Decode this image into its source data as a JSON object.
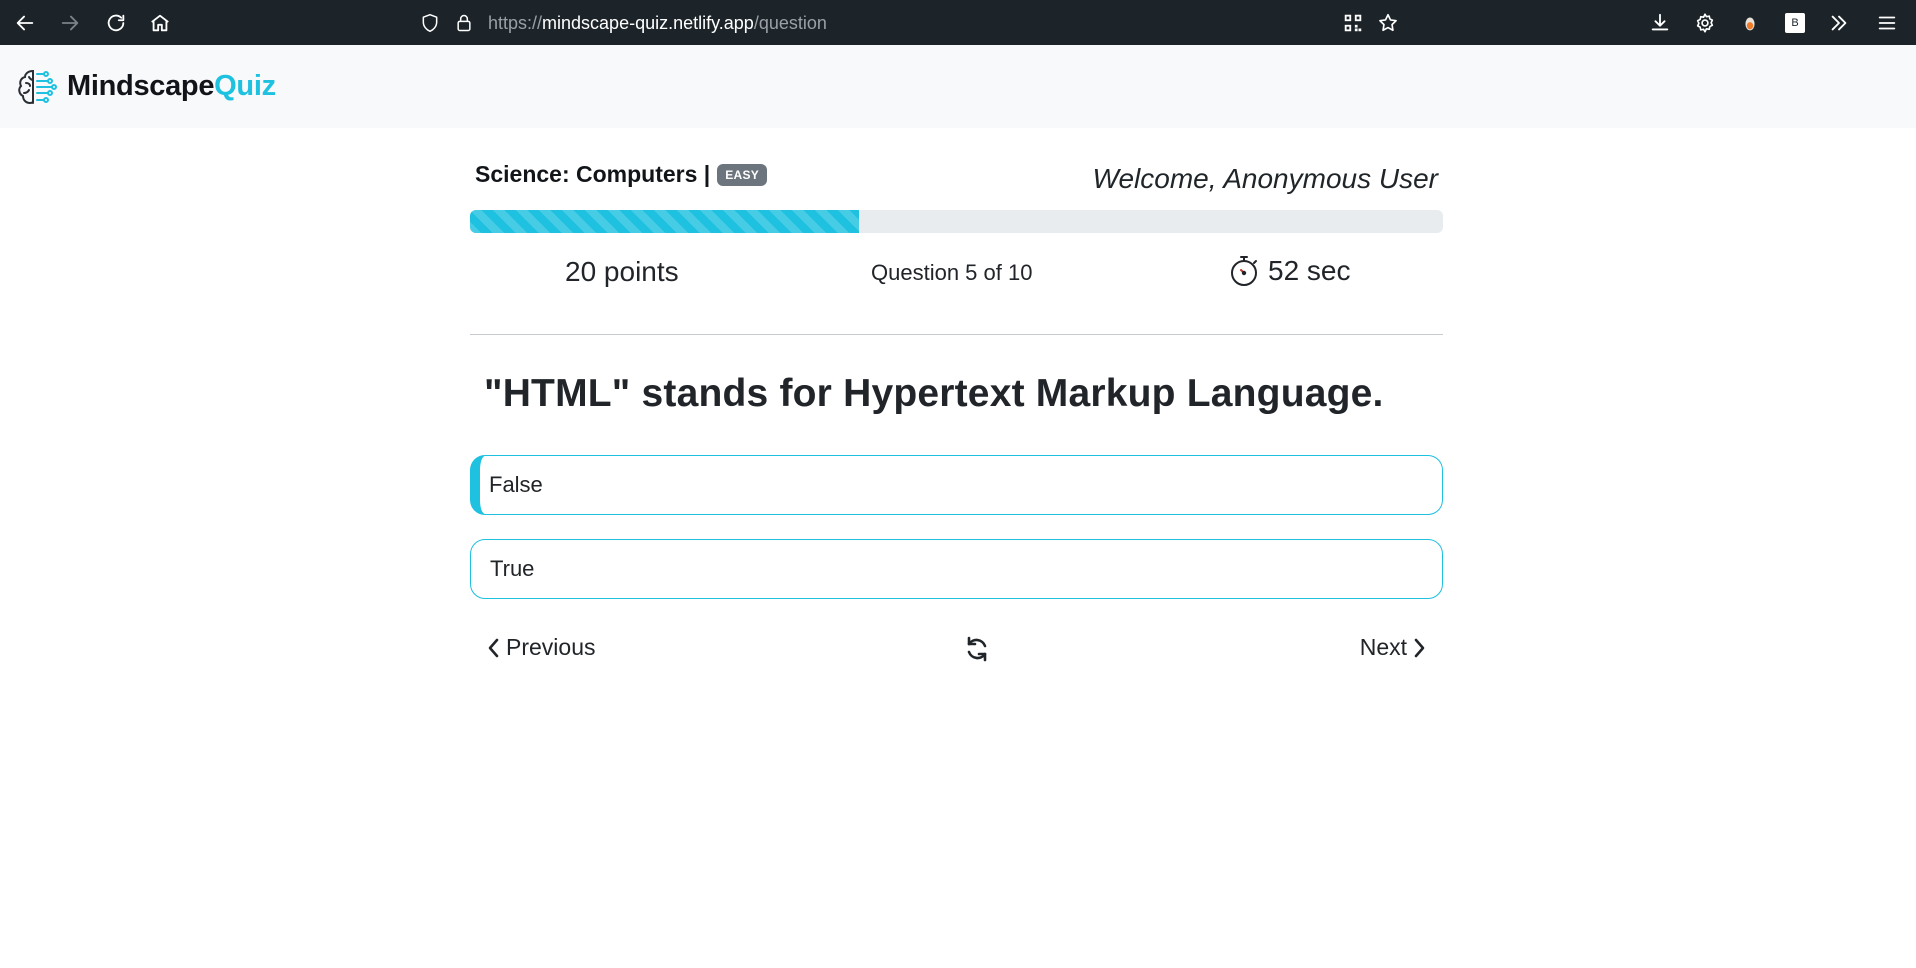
{
  "browser": {
    "url_scheme": "https://",
    "url_host": "mindscape-quiz.netlify.app",
    "url_path": "/question",
    "extension_badge": "B"
  },
  "brand": {
    "name_main": "Mindscape",
    "name_accent": "Quiz"
  },
  "quiz": {
    "category": "Science: Computers |",
    "difficulty": "EASY",
    "welcome": "Welcome, Anonymous User",
    "progress_fraction": 0.4,
    "points": "20 points",
    "question_counter": "Question 5 of 10",
    "timer": "52 sec",
    "question": "\"HTML\" stands for Hypertext Markup Language.",
    "answers": [
      {
        "label": "False",
        "selected": true
      },
      {
        "label": "True",
        "selected": false
      }
    ],
    "previous_label": "Previous",
    "next_label": "Next"
  },
  "colors": {
    "accent": "#1ec1e0",
    "browser_bar": "#1c2429",
    "header_bg": "#f8f9fa",
    "badge": "#6c757d"
  },
  "icons": {
    "back": "arrow-left-icon",
    "forward": "arrow-right-icon",
    "reload": "reload-icon",
    "home": "home-icon",
    "shield": "shield-icon",
    "lock": "lock-icon",
    "qr": "qr-code-icon",
    "bookmark": "star-icon",
    "download": "download-icon",
    "settings": "gear-icon",
    "extension": "extension-icon",
    "overflow": "chevrons-right-icon",
    "menu": "hamburger-icon",
    "logo": "brain-circuit-icon",
    "timer": "stopwatch-icon",
    "restart": "refresh-icon"
  }
}
